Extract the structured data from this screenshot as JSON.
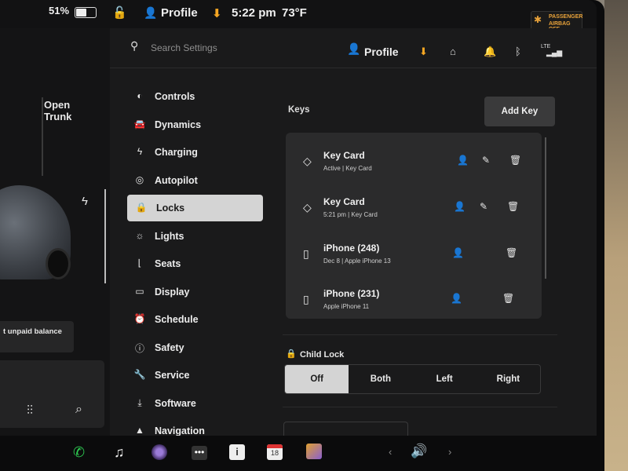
{
  "status": {
    "battery": "51%",
    "profile": "Profile",
    "time": "5:22 pm",
    "temperature": "73°F",
    "airbag_line1": "PASSENGER",
    "airbag_line2": "AIRBAG OFF"
  },
  "car": {
    "open_trunk": "Open Trunk",
    "unpaid": "t unpaid balance"
  },
  "header": {
    "search_placeholder": "Search Settings",
    "profile": "Profile",
    "lte": "LTE"
  },
  "nav": {
    "items": [
      {
        "label": "Controls",
        "icon": "toggle-icon"
      },
      {
        "label": "Dynamics",
        "icon": "car-icon"
      },
      {
        "label": "Charging",
        "icon": "bolt-icon"
      },
      {
        "label": "Autopilot",
        "icon": "steering-wheel-icon"
      },
      {
        "label": "Locks",
        "icon": "lock-icon"
      },
      {
        "label": "Lights",
        "icon": "sun-icon"
      },
      {
        "label": "Seats",
        "icon": "seat-icon"
      },
      {
        "label": "Display",
        "icon": "display-icon"
      },
      {
        "label": "Schedule",
        "icon": "alarm-icon"
      },
      {
        "label": "Safety",
        "icon": "info-icon"
      },
      {
        "label": "Service",
        "icon": "wrench-icon"
      },
      {
        "label": "Software",
        "icon": "download-icon"
      },
      {
        "label": "Navigation",
        "icon": "navigation-icon"
      }
    ],
    "active_index": 4
  },
  "keys": {
    "title": "Keys",
    "add_label": "Add Key",
    "items": [
      {
        "name": "Key Card",
        "sub": "Active | Key Card",
        "icon": "key-card-icon",
        "editable": true
      },
      {
        "name": "Key Card",
        "sub": "5:21 pm | Key Card",
        "icon": "key-card-icon",
        "editable": true
      },
      {
        "name": "iPhone (248)",
        "sub": "Dec 8 | Apple iPhone 13",
        "icon": "phone-icon",
        "editable": false
      },
      {
        "name": "iPhone (231)",
        "sub": "Apple iPhone 11",
        "icon": "phone-icon",
        "editable": false
      }
    ]
  },
  "child_lock": {
    "title": "Child Lock",
    "options": [
      "Off",
      "Both",
      "Left",
      "Right"
    ],
    "selected": "Off"
  },
  "taskbar": {
    "calendar_day": "18"
  },
  "colors": {
    "accent_download": "#f5a623",
    "phone_green": "#2ecc52",
    "airbag_orange": "#e8a23a"
  }
}
